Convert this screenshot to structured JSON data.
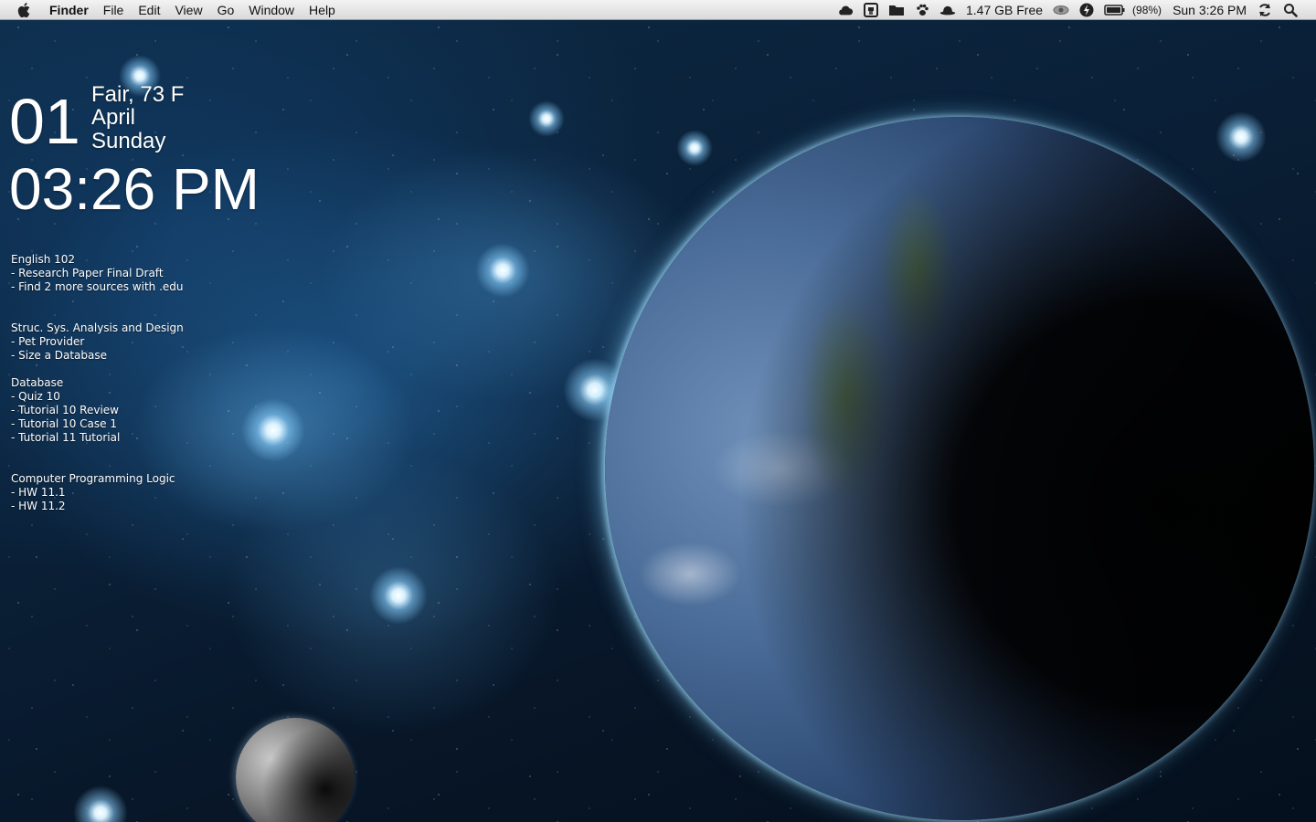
{
  "menubar": {
    "apple_icon": "apple-logo-icon",
    "app_name": "Finder",
    "menus": [
      "File",
      "Edit",
      "View",
      "Go",
      "Window",
      "Help"
    ],
    "status": {
      "icons": [
        "cloud-icon",
        "screen-icon",
        "folder-icon",
        "paw-icon",
        "hat-icon"
      ],
      "disk_free": "1.47 GB Free",
      "battery_pct": "(98%)",
      "clock": "Sun 3:26 PM"
    }
  },
  "desktop_clock": {
    "day": "01",
    "weather": "Fair, 73 F",
    "month": "April",
    "weekday": "Sunday",
    "time": "03:26 PM"
  },
  "todo": [
    {
      "title": "English 102",
      "items": [
        "- Research Paper Final Draft",
        "- Find 2 more sources with .edu"
      ]
    },
    {
      "title": "Struc. Sys. Analysis and Design",
      "items": [
        "- Pet Provider",
        "- Size a Database"
      ]
    },
    {
      "title": "Database",
      "items": [
        "- Quiz 10",
        "- Tutorial 10 Review",
        "- Tutorial 10 Case 1",
        "- Tutorial 11 Tutorial"
      ]
    },
    {
      "title": "Computer Programming Logic",
      "items": [
        "- HW 11.1",
        "- HW 11.2"
      ]
    }
  ]
}
